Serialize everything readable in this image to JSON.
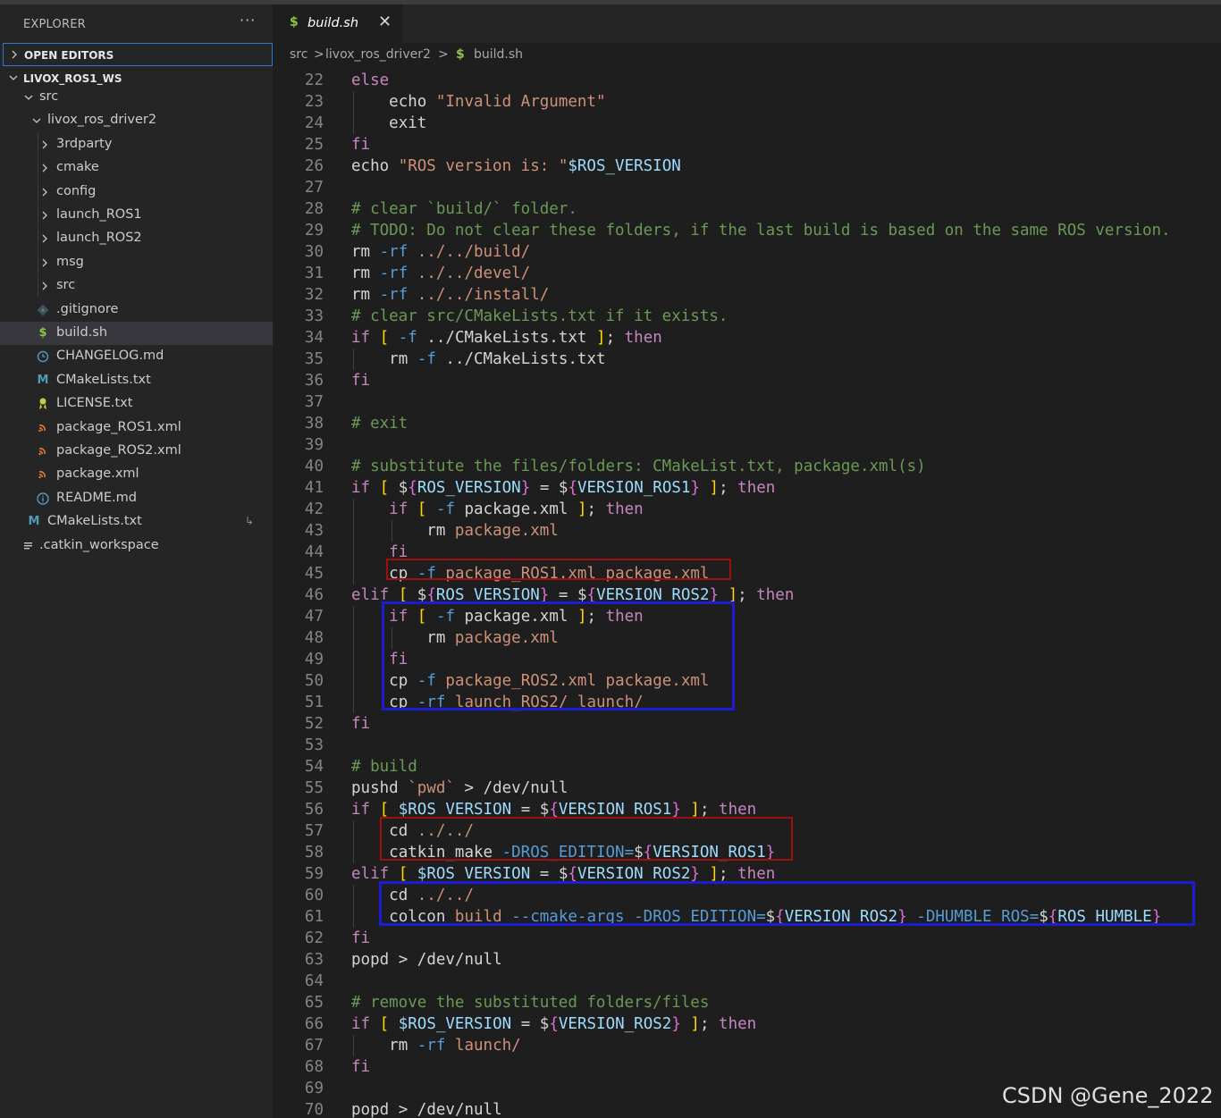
{
  "sidebar": {
    "title": "EXPLORER",
    "more_label": "···",
    "open_editors_label": "OPEN EDITORS",
    "workspace_label": "LIVOX_ROS1_WS",
    "tree": [
      {
        "label": "src",
        "icon": "folder-chevron"
      },
      {
        "label": "livox_ros_driver2",
        "icon": "folder-chevron"
      },
      {
        "label": "3rdparty",
        "icon": "folder-chevron"
      },
      {
        "label": "cmake",
        "icon": "folder-chevron"
      },
      {
        "label": "config",
        "icon": "folder-chevron"
      },
      {
        "label": "launch_ROS1",
        "icon": "folder-chevron"
      },
      {
        "label": "launch_ROS2",
        "icon": "folder-chevron"
      },
      {
        "label": "msg",
        "icon": "folder-chevron"
      },
      {
        "label": "src",
        "icon": "folder-chevron"
      },
      {
        "label": ".gitignore",
        "icon": "git-icon"
      },
      {
        "label": "build.sh",
        "icon": "shell-icon"
      },
      {
        "label": "CHANGELOG.md",
        "icon": "changelog-icon"
      },
      {
        "label": "CMakeLists.txt",
        "icon": "cmake-icon"
      },
      {
        "label": "LICENSE.txt",
        "icon": "license-icon"
      },
      {
        "label": "package_ROS1.xml",
        "icon": "xml-icon"
      },
      {
        "label": "package_ROS2.xml",
        "icon": "xml-icon"
      },
      {
        "label": "package.xml",
        "icon": "xml-icon"
      },
      {
        "label": "README.md",
        "icon": "info-icon"
      },
      {
        "label": "CMakeLists.txt",
        "icon": "cmake-icon",
        "trailing": "↳"
      },
      {
        "label": ".catkin_workspace",
        "icon": "text-file-icon"
      }
    ],
    "icon_glyphs": {
      "shell": "$",
      "cmake": "M",
      "xml": "))",
      "info": "ⓘ",
      "changelog": "◷",
      "git": "◈",
      "license": "🎗",
      "text": "≡"
    }
  },
  "tab": {
    "label": "build.sh",
    "icon": "$",
    "close": "✕"
  },
  "breadcrumb": {
    "parts": [
      "src",
      ">",
      "livox_ros_driver2",
      ">",
      "$",
      "build.sh"
    ]
  },
  "code": {
    "lines": [
      {
        "n": "22",
        "t": "else"
      },
      {
        "n": "23",
        "t": "    echo \"Invalid Argument\""
      },
      {
        "n": "24",
        "t": "    exit"
      },
      {
        "n": "25",
        "t": "fi"
      },
      {
        "n": "26",
        "t": "echo \"ROS version is: \"$ROS_VERSION"
      },
      {
        "n": "27",
        "t": ""
      },
      {
        "n": "28",
        "t": "# clear `build/` folder."
      },
      {
        "n": "29",
        "t": "# TODO: Do not clear these folders, if the last build is based on the same ROS version."
      },
      {
        "n": "30",
        "t": "rm -rf ../../build/"
      },
      {
        "n": "31",
        "t": "rm -rf ../../devel/"
      },
      {
        "n": "32",
        "t": "rm -rf ../../install/"
      },
      {
        "n": "33",
        "t": "# clear src/CMakeLists.txt if it exists."
      },
      {
        "n": "34",
        "t": "if [ -f ../CMakeLists.txt ]; then"
      },
      {
        "n": "35",
        "t": "    rm -f ../CMakeLists.txt"
      },
      {
        "n": "36",
        "t": "fi"
      },
      {
        "n": "37",
        "t": ""
      },
      {
        "n": "38",
        "t": "# exit"
      },
      {
        "n": "39",
        "t": ""
      },
      {
        "n": "40",
        "t": "# substitute the files/folders: CMakeList.txt, package.xml(s)"
      },
      {
        "n": "41",
        "t": "if [ ${ROS_VERSION} = ${VERSION_ROS1} ]; then"
      },
      {
        "n": "42",
        "t": "    if [ -f package.xml ]; then"
      },
      {
        "n": "43",
        "t": "        rm package.xml"
      },
      {
        "n": "44",
        "t": "    fi"
      },
      {
        "n": "45",
        "t": "    cp -f package_ROS1.xml package.xml"
      },
      {
        "n": "46",
        "t": "elif [ ${ROS_VERSION} = ${VERSION_ROS2} ]; then"
      },
      {
        "n": "47",
        "t": "    if [ -f package.xml ]; then"
      },
      {
        "n": "48",
        "t": "        rm package.xml"
      },
      {
        "n": "49",
        "t": "    fi"
      },
      {
        "n": "50",
        "t": "    cp -f package_ROS2.xml package.xml"
      },
      {
        "n": "51",
        "t": "    cp -rf launch_ROS2/ launch/"
      },
      {
        "n": "52",
        "t": "fi"
      },
      {
        "n": "53",
        "t": ""
      },
      {
        "n": "54",
        "t": "# build"
      },
      {
        "n": "55",
        "t": "pushd `pwd` > /dev/null"
      },
      {
        "n": "56",
        "t": "if [ $ROS_VERSION = ${VERSION_ROS1} ]; then"
      },
      {
        "n": "57",
        "t": "    cd ../../"
      },
      {
        "n": "58",
        "t": "    catkin_make -DROS_EDITION=${VERSION_ROS1}"
      },
      {
        "n": "59",
        "t": "elif [ $ROS_VERSION = ${VERSION_ROS2} ]; then"
      },
      {
        "n": "60",
        "t": "    cd ../../"
      },
      {
        "n": "61",
        "t": "    colcon build --cmake-args -DROS_EDITION=${VERSION_ROS2} -DHUMBLE_ROS=${ROS_HUMBLE}"
      },
      {
        "n": "62",
        "t": "fi"
      },
      {
        "n": "63",
        "t": "popd > /dev/null"
      },
      {
        "n": "64",
        "t": ""
      },
      {
        "n": "65",
        "t": "# remove the substituted folders/files"
      },
      {
        "n": "66",
        "t": "if [ $ROS_VERSION = ${VERSION_ROS2} ]; then"
      },
      {
        "n": "67",
        "t": "    rm -rf launch/"
      },
      {
        "n": "68",
        "t": "fi"
      },
      {
        "n": "69",
        "t": ""
      },
      {
        "n": "70",
        "t": "popd > /dev/null"
      }
    ]
  },
  "watermark": "CSDN @Gene_2022",
  "colors": {
    "keyword": "#c586c0",
    "string": "#ce9178",
    "comment": "#6a9955",
    "variable": "#9cdcfe",
    "option": "#569cd6",
    "bracket": "#ffd700",
    "highlight_red": "#9e1010",
    "highlight_blue": "#1c1cd4",
    "focus_border": "#2b79d0"
  }
}
